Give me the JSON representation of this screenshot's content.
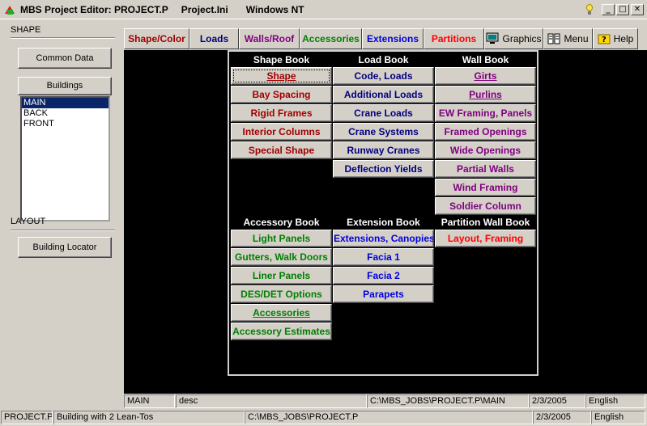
{
  "window": {
    "title_app": "MBS Project Editor: PROJECT.P",
    "title_ini": "Project.Ini",
    "title_os": "Windows NT",
    "controls": [
      "_",
      "□",
      "✕"
    ]
  },
  "sidebar": {
    "shape_label": "SHAPE",
    "common_data": "Common Data",
    "buildings_header": "Buildings",
    "buildings": [
      "MAIN",
      "BACK",
      "FRONT"
    ],
    "selected_building": "MAIN",
    "layout_label": "LAYOUT",
    "building_locator": "Building Locator"
  },
  "tabs": [
    {
      "label": "Shape/Color",
      "color": "#a00000"
    },
    {
      "label": "Loads",
      "color": "#00007f"
    },
    {
      "label": "Walls/Roof",
      "color": "#800080"
    },
    {
      "label": "Accessories",
      "color": "#007f00"
    },
    {
      "label": "Extensions",
      "color": "#0000dd"
    },
    {
      "label": "Partitions",
      "color": "#ff0000"
    },
    {
      "label": "Graphics",
      "icon": "monitor-icon"
    },
    {
      "label": "Menu",
      "icon": "book-icon"
    },
    {
      "label": "Help",
      "icon": "help-icon"
    }
  ],
  "books": {
    "shape": {
      "title": "Shape Book",
      "items": [
        "Shape",
        "Bay Spacing",
        "Rigid Frames",
        "Interior Columns",
        "Special Shape"
      ]
    },
    "load": {
      "title": "Load Book",
      "items": [
        "Code, Loads",
        "Additional Loads",
        "Crane Loads",
        "Crane Systems",
        "Runway Cranes",
        "Deflection Yields"
      ]
    },
    "wall": {
      "title": "Wall Book",
      "items": [
        "Girts",
        "Purlins",
        "EW Framing, Panels",
        "Framed Openings",
        "Wide Openings",
        "Partial Walls",
        "Wind Framing",
        "Soldier Column"
      ]
    },
    "accessory": {
      "title": "Accessory Book",
      "items": [
        "Light Panels",
        "Gutters, Walk Doors",
        "Liner Panels",
        "DES/DET Options",
        "Accessories",
        "Accessory Estimates"
      ]
    },
    "extension": {
      "title": "Extension Book",
      "items": [
        "Extensions, Canopies",
        "Facia 1",
        "Facia 2",
        "Parapets"
      ]
    },
    "partition": {
      "title": "Partition Wall Book",
      "items": [
        "Layout, Framing"
      ]
    }
  },
  "status_inner": {
    "building": "MAIN",
    "desc": "desc",
    "path": "C:\\MBS_JOBS\\PROJECT.P\\MAIN",
    "date": "2/3/2005",
    "language": "English"
  },
  "status_outer": {
    "project": "PROJECT.P",
    "description": "Building with 2 Lean-Tos",
    "path": "C:\\MBS_JOBS\\PROJECT.P",
    "date": "2/3/2005",
    "language": "English"
  }
}
